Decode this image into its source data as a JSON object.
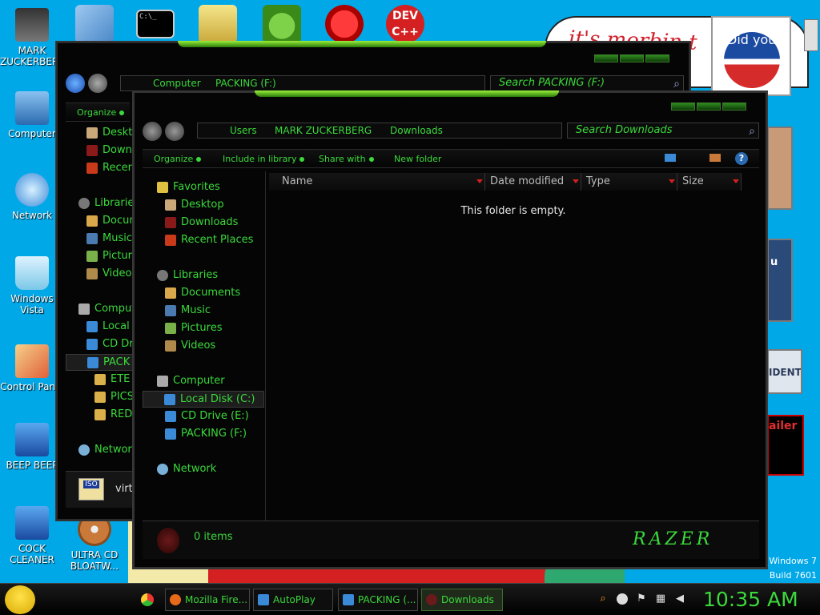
{
  "desktop": {
    "left_icons": [
      {
        "label": "MARK ZUCKERBERG",
        "name": "desktop-icon-mark-zuckerberg"
      },
      {
        "label": "Computer",
        "name": "desktop-icon-computer"
      },
      {
        "label": "Network",
        "name": "desktop-icon-network"
      },
      {
        "label": "Windows Vista",
        "name": "desktop-icon-windows-vista"
      },
      {
        "label": "Control Panel",
        "name": "desktop-icon-control-panel"
      },
      {
        "label": "BEEP BEEP",
        "name": "desktop-icon-beep-beep"
      },
      {
        "label": "COCK CLEANER",
        "name": "desktop-icon-cock-cleaner"
      },
      {
        "label": "ULTRA CD BLOATW...",
        "name": "desktop-icon-ultra-cd"
      }
    ],
    "top_icon_dev_label": "DEV C++",
    "top_icon_cmd_label": "C:\\_",
    "wallpaper_text": "it's morbin t",
    "obama_text": "Did you",
    "side_texts": {
      "ident": "IDENT",
      "ailer": "ailer",
      "u": "u"
    },
    "watermark_os": "Windows 7",
    "watermark_build": "Build 7601",
    "behind_hint": "a"
  },
  "back_window": {
    "address": [
      "Computer",
      "PACKING (F:)"
    ],
    "search_placeholder": "Search PACKING (F:)",
    "toolbar_organize": "Organize",
    "nav": [
      "Deskt",
      "Downl",
      "Recen",
      "Libraries",
      "Docun",
      "Music",
      "Pictur",
      "Videos",
      "Comput",
      "Local",
      "CD Dr",
      "PACK",
      "ETE",
      "PICS",
      "RED",
      "Network"
    ],
    "iso_label": "ISO",
    "virt_label": "virti"
  },
  "front_window": {
    "address": [
      "Users",
      "MARK ZUCKERBERG",
      "Downloads"
    ],
    "search_placeholder": "Search Downloads",
    "toolbar": {
      "organize": "Organize",
      "include": "Include in library",
      "share": "Share with",
      "new_folder": "New folder"
    },
    "help_label": "?",
    "nav": {
      "favorites": "Favorites",
      "desktop": "Desktop",
      "downloads": "Downloads",
      "recent": "Recent Places",
      "libraries": "Libraries",
      "documents": "Documents",
      "music": "Music",
      "pictures": "Pictures",
      "videos": "Videos",
      "computer": "Computer",
      "local_disk": "Local Disk (C:)",
      "cd_drive": "CD Drive (E:)",
      "packing": "PACKING (F:)",
      "network": "Network"
    },
    "columns": [
      "Name",
      "Date modified",
      "Type",
      "Size"
    ],
    "empty_text": "This folder is empty.",
    "status_items": "0 items",
    "brand": "RAZER"
  },
  "taskbar": {
    "buttons": [
      "Mozilla Fire...",
      "AutoPlay",
      "PACKING (...",
      "Downloads"
    ],
    "clock": "10:35 AM"
  }
}
